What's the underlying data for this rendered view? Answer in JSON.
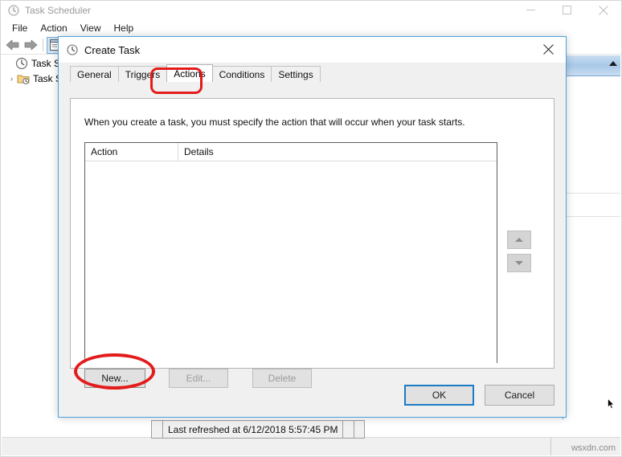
{
  "main_window": {
    "title": "Task Scheduler",
    "app_icon": "clock-icon",
    "controls": {
      "minimize": "minimize-icon",
      "maximize": "maximize-icon",
      "close": "close-icon"
    },
    "menu": [
      "File",
      "Action",
      "View",
      "Help"
    ],
    "toolbar": {
      "back": "back-arrow-icon",
      "forward": "forward-arrow-icon",
      "properties": "window-properties-icon"
    },
    "tree": [
      {
        "label": "Task Sche",
        "icon": "clock-icon",
        "expander": ""
      },
      {
        "label": "Task S",
        "icon": "folder-clock-icon",
        "expander": "›"
      }
    ],
    "status": {
      "refreshed": "Last refreshed at 6/12/2018 5:57:45 PM"
    },
    "watermark": "wsxdn.com"
  },
  "dialog": {
    "title": "Create Task",
    "icon": "clock-icon",
    "close": "close-icon",
    "tabs": [
      {
        "label": "General",
        "active": false
      },
      {
        "label": "Triggers",
        "active": false
      },
      {
        "label": "Actions",
        "active": true
      },
      {
        "label": "Conditions",
        "active": false
      },
      {
        "label": "Settings",
        "active": false
      }
    ],
    "hint": "When you create a task, you must specify the action that will occur when your task starts.",
    "list": {
      "columns": [
        "Action",
        "Details"
      ],
      "rows": []
    },
    "move_buttons": {
      "up": "triangle-up-icon",
      "down": "triangle-down-icon"
    },
    "action_buttons": [
      {
        "label": "New...",
        "enabled": true
      },
      {
        "label": "Edit...",
        "enabled": false
      },
      {
        "label": "Delete",
        "enabled": false
      }
    ],
    "footer": {
      "ok": "OK",
      "cancel": "Cancel"
    }
  },
  "annotations": {
    "accent_color": "#e31b1b",
    "highlighted": [
      "Actions",
      "New..."
    ]
  }
}
